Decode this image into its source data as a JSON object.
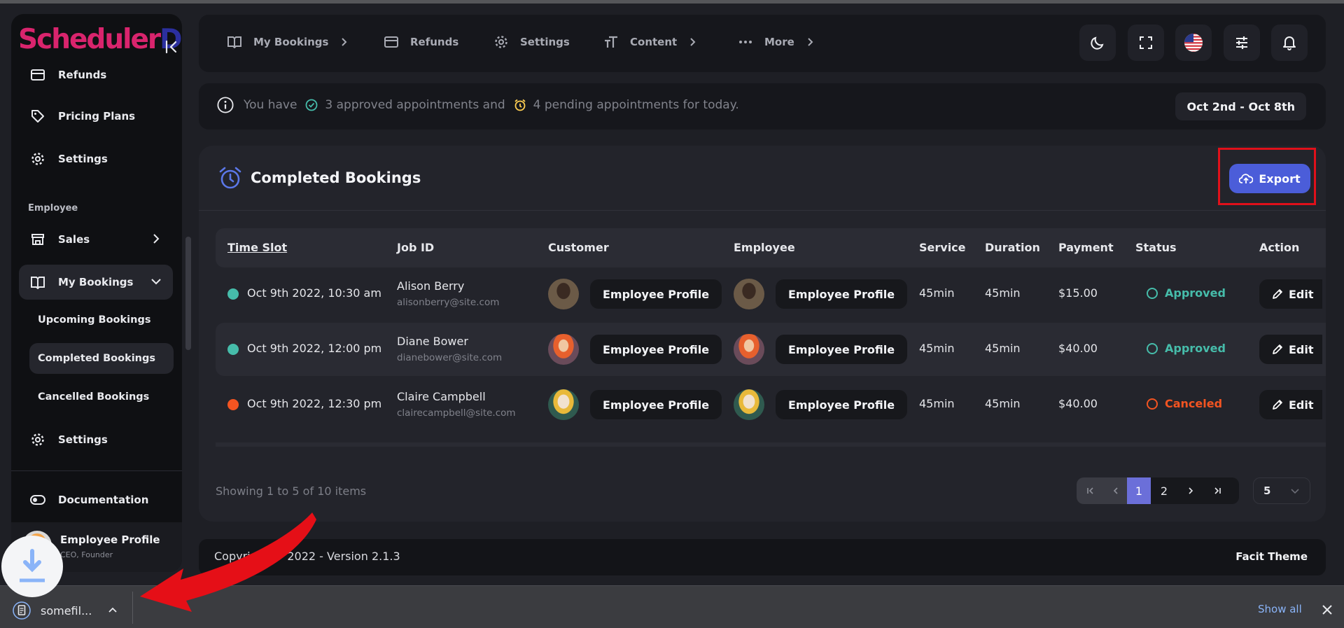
{
  "brand": {
    "part1": "Scheduler",
    "part2": "Desk"
  },
  "sidebar": {
    "items": [
      {
        "label": "Refunds",
        "icon": "credit-card-icon"
      },
      {
        "label": "Pricing Plans",
        "icon": "tag-icon"
      },
      {
        "label": "Settings",
        "icon": "gear-icon"
      }
    ],
    "section_label": "Employee",
    "employee_items": [
      {
        "label": "Sales",
        "icon": "store-icon"
      },
      {
        "label": "My Bookings",
        "icon": "book-icon"
      }
    ],
    "sub_items": [
      "Upcoming Bookings",
      "Completed Bookings",
      "Cancelled Bookings"
    ],
    "settings2": "Settings",
    "documentation": "Documentation",
    "profile": {
      "name": "Employee Profile",
      "role": "CEO, Founder"
    }
  },
  "topnav": {
    "items": [
      {
        "label": "My Bookings",
        "icon": "book-icon"
      },
      {
        "label": "Refunds",
        "icon": "credit-card-icon"
      },
      {
        "label": "Settings",
        "icon": "gear-icon"
      },
      {
        "label": "Content",
        "icon": "text-size-icon"
      },
      {
        "label": "More",
        "icon": "more-dots-icon"
      }
    ]
  },
  "info": {
    "prefix": "You have",
    "approved": "3 approved appointments and",
    "pending": "4 pending appointments for today.",
    "date_range": "Oct 2nd - Oct 8th"
  },
  "card": {
    "title": "Completed Bookings",
    "export_label": "Export",
    "columns": [
      "Time Slot",
      "Job ID",
      "Customer",
      "Employee",
      "Service",
      "Duration",
      "Payment",
      "Status",
      "Action"
    ],
    "rows": [
      {
        "time": "Oct 9th 2022, 10:30 am",
        "dot_color": "#46bcaa",
        "name": "Alison Berry",
        "email": "alisonberry@site.com",
        "customer": "Employee Profile",
        "employee": "Employee Profile",
        "service": "45min",
        "duration": "45min",
        "payment": "$15.00",
        "status": "Approved",
        "status_color": "#46bcaa",
        "action": "Edit"
      },
      {
        "time": "Oct 9th 2022, 12:00 pm",
        "dot_color": "#46bcaa",
        "name": "Diane Bower",
        "email": "dianebower@site.com",
        "customer": "Employee Profile",
        "employee": "Employee Profile",
        "service": "45min",
        "duration": "45min",
        "payment": "$40.00",
        "status": "Approved",
        "status_color": "#46bcaa",
        "action": "Edit"
      },
      {
        "time": "Oct 9th 2022, 12:30 pm",
        "dot_color": "#f35421",
        "name": "Claire Campbell",
        "email": "clairecampbell@site.com",
        "customer": "Employee Profile",
        "employee": "Employee Profile",
        "service": "45min",
        "duration": "45min",
        "payment": "$40.00",
        "status": "Canceled",
        "status_color": "#f35421",
        "action": "Edit"
      }
    ],
    "showing": "Showing 1 to 5 of 10 items",
    "pages": [
      "1",
      "2"
    ],
    "per_page": "5"
  },
  "footer": {
    "copyright": "Copyright © 2022 - Version 2.1.3",
    "theme": "Facit Theme"
  },
  "download": {
    "filename": "somefil...",
    "show_all": "Show all"
  }
}
